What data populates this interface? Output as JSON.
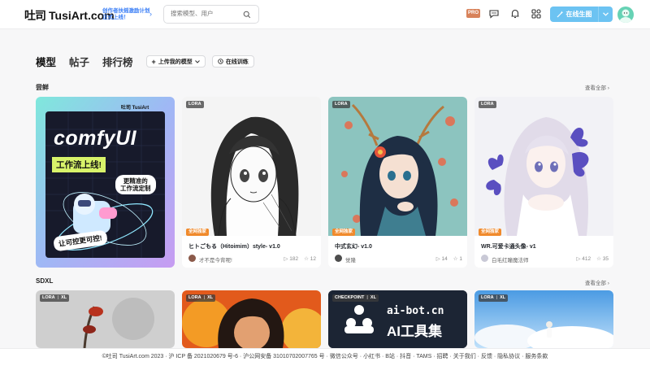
{
  "header": {
    "logo_mark": "吐司",
    "logo_text": "TusiArt.com",
    "promo_line1": "创作者扶摇激励计划",
    "promo_line2": "正式上线！",
    "search_placeholder": "搜索模型、用户",
    "pro_label": "PRO",
    "generate_label": "在线生图",
    "accent": "#6cc3f2"
  },
  "tabs": [
    {
      "label": "模型"
    },
    {
      "label": "帖子"
    },
    {
      "label": "排行榜"
    }
  ],
  "actions": {
    "upload_label": "上传我的模型",
    "train_label": "在线训练"
  },
  "sections": [
    {
      "title": "尝鲜",
      "see_all": "查看全部 ›"
    },
    {
      "title": "SDXL",
      "see_all": "查看全部 ›"
    }
  ],
  "row1": [
    {
      "banner_brand": "吐司 TusiArt",
      "banner_title": "comfyUI",
      "banner_sub": "工作流上线!",
      "banner_bubble1": "更精准的",
      "banner_bubble2": "工作流定制",
      "banner_bubble3": "让可控更可控!"
    },
    {
      "tag": "LORA",
      "exclusive": "全网独家",
      "title": "ヒトごもる（Hitoimim）style- v1.0",
      "author": "才不是今背呢!",
      "views": "182",
      "likes": "12"
    },
    {
      "tag": "LORA",
      "exclusive": "全网独家",
      "title": "中式玄幻- v1.0",
      "author": "觉隆",
      "views": "14",
      "likes": "1"
    },
    {
      "tag": "LORA",
      "exclusive": "全网独家",
      "title": "WR.可爱卡通头像- v1",
      "author": "白毛红瞳魔法师",
      "views": "412",
      "likes": "35"
    }
  ],
  "row2": [
    {
      "tag": "LORA",
      "tag2": "XL"
    },
    {
      "tag": "LORA",
      "tag2": "XL"
    },
    {
      "tag": "CHECKPOINT",
      "tag2": "XL",
      "brand_url": "ai-bot.cn",
      "brand_name": "AI工具集"
    },
    {
      "tag": "LORA",
      "tag2": "XL"
    }
  ],
  "footer": {
    "text": "©吐司 TusiArt.com 2023 · 沪 ICP 备 2021020679 号-6 · 沪公网安备 31010702007765 号 · 微信公众号 · 小红书 · B站 · 抖音 · TAMS · 招聘 · 关于我们 · 反馈 · 隐私协议 · 服务条款"
  }
}
